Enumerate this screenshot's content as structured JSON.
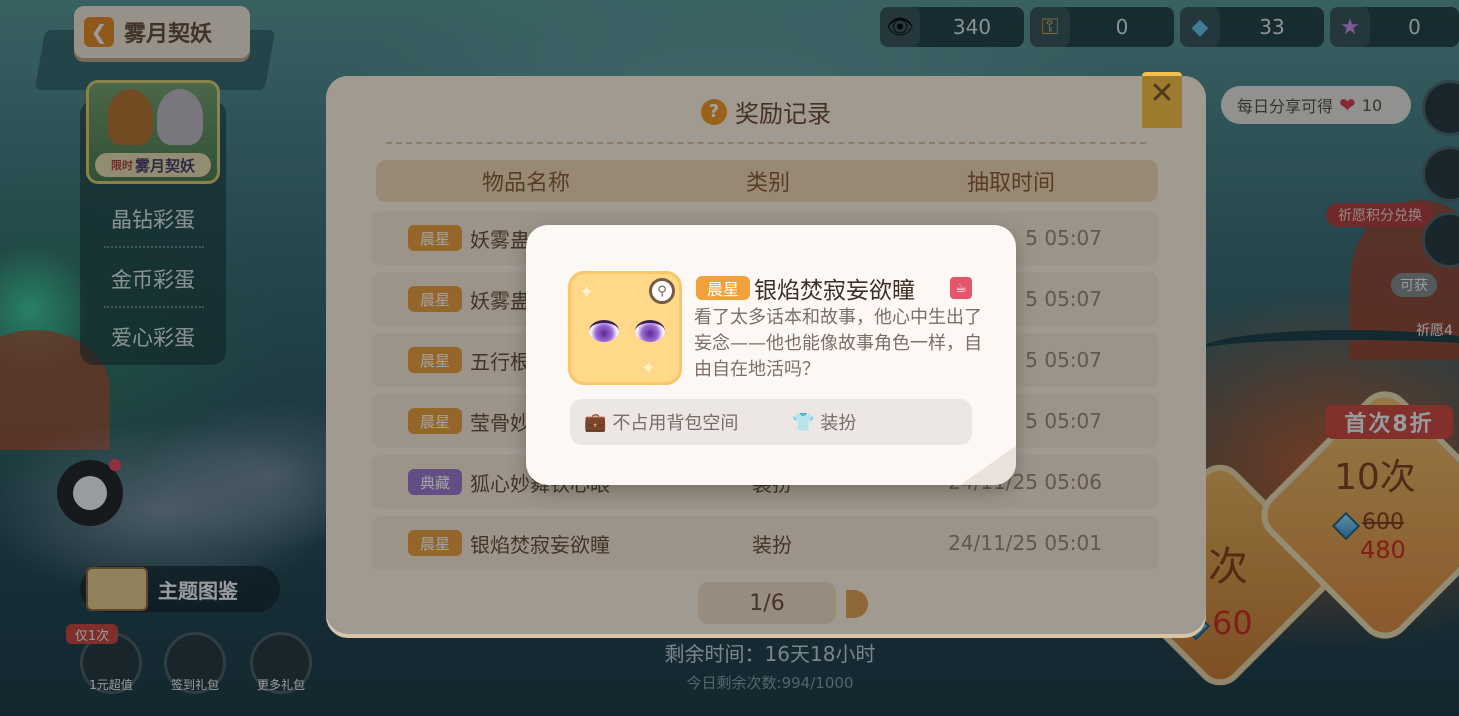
{
  "title": "雾月契妖",
  "currencies": [
    {
      "icon": "eye-ticket-icon",
      "value": "340"
    },
    {
      "icon": "key-icon",
      "value": "0"
    },
    {
      "icon": "gem-plus-icon",
      "value": "33"
    },
    {
      "icon": "wand-icon",
      "value": "0"
    }
  ],
  "left_menu": {
    "banner_tag": "限时",
    "banner_label": "雾月契妖",
    "items": [
      "晶钻彩蛋",
      "金币彩蛋",
      "爱心彩蛋"
    ]
  },
  "share": {
    "label": "每日分享可得",
    "value": "10"
  },
  "side": {
    "exchange": "祈愿积分兑换",
    "available": "可获",
    "wish": "祈愿4"
  },
  "draw": {
    "discount": "首次8折",
    "ten": "10次",
    "old_price": "600",
    "new_price": "480",
    "one": "次",
    "one_price": "60"
  },
  "bottom": {
    "theme": "主题图鉴",
    "once": "仅1次",
    "btn1": "1元超值",
    "btn2": "签到礼包",
    "btn3": "更多礼包",
    "remaining": "剩余时间：16天18小时",
    "today": "今日剩余次数:994/1000"
  },
  "panel": {
    "title": "奖励记录",
    "headers": [
      "物品名称",
      "类别",
      "抽取时间"
    ],
    "rows": [
      {
        "badge": "晨星",
        "badge_color": "#e8a040",
        "name": "妖雾蛊",
        "type": "",
        "time": "5 05:07"
      },
      {
        "badge": "晨星",
        "badge_color": "#e8a040",
        "name": "妖雾蛊",
        "type": "",
        "time": "5 05:07"
      },
      {
        "badge": "晨星",
        "badge_color": "#e8a040",
        "name": "五行根",
        "type": "",
        "time": "5 05:07"
      },
      {
        "badge": "晨星",
        "badge_color": "#e8a040",
        "name": "莹骨妙",
        "type": "",
        "time": "5 05:07"
      },
      {
        "badge": "典藏",
        "badge_color": "#9a7ad0",
        "name": "狐心妙舞铁心眼",
        "type": "装扮",
        "time": "24/11/25 05:06"
      },
      {
        "badge": "晨星",
        "badge_color": "#e8a040",
        "name": "银焰焚寂妄欲瞳",
        "type": "装扮",
        "time": "24/11/25 05:01"
      }
    ],
    "page": "1/6"
  },
  "item_popup": {
    "badge": "晨星",
    "name": "银焰焚寂妄欲瞳",
    "description": "看了太多话本和故事，他心中生出了妄念——他也能像故事角色一样，自由自在地活吗？",
    "tag1": "不占用背包空间",
    "tag2": "装扮"
  },
  "colors": {
    "accent": "#f09a2a",
    "badge_morning": "#f0a23a",
    "badge_collection": "#9a7ad0",
    "price_red": "#d8261a"
  }
}
